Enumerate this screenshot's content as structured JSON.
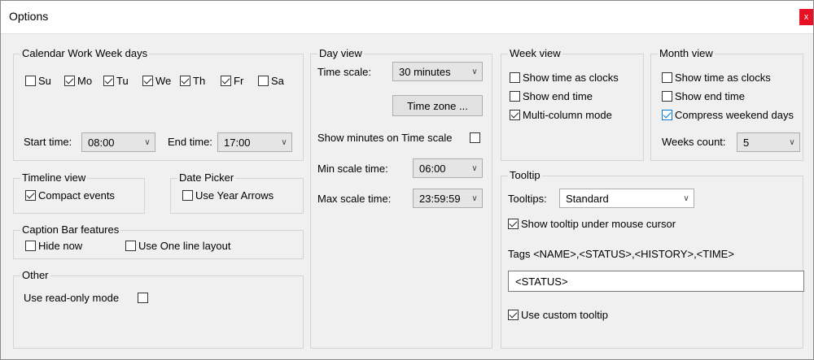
{
  "window": {
    "title": "Options",
    "close_glyph": "x"
  },
  "calendar_work_week": {
    "title": "Calendar Work Week days",
    "days": [
      {
        "label": "Su",
        "checked": false
      },
      {
        "label": "Mo",
        "checked": true
      },
      {
        "label": "Tu",
        "checked": true
      },
      {
        "label": "We",
        "checked": true
      },
      {
        "label": "Th",
        "checked": true
      },
      {
        "label": "Fr",
        "checked": true
      },
      {
        "label": "Sa",
        "checked": false
      }
    ],
    "start_time_label": "Start time:",
    "start_time_value": "08:00",
    "end_time_label": "End time:",
    "end_time_value": "17:00"
  },
  "timeline_view": {
    "title": "Timeline view",
    "compact_events_label": "Compact events",
    "compact_events_checked": true
  },
  "date_picker": {
    "title": "Date Picker",
    "use_year_arrows_label": "Use Year Arrows",
    "use_year_arrows_checked": false
  },
  "caption_bar": {
    "title": "Caption Bar features",
    "hide_now_label": "Hide now",
    "hide_now_checked": false,
    "one_line_label": "Use One line layout",
    "one_line_checked": false
  },
  "other": {
    "title": "Other",
    "read_only_label": "Use read-only mode",
    "read_only_checked": false
  },
  "day_view": {
    "title": "Day view",
    "time_scale_label": "Time scale:",
    "time_scale_value": "30 minutes",
    "time_zone_button": "Time zone ...",
    "show_minutes_label": "Show minutes on Time scale",
    "show_minutes_checked": false,
    "min_scale_label": "Min scale time:",
    "min_scale_value": "06:00",
    "max_scale_label": "Max scale time:",
    "max_scale_value": "23:59:59"
  },
  "week_view": {
    "title": "Week view",
    "clocks_label": "Show time as clocks",
    "clocks_checked": false,
    "end_time_label": "Show end time",
    "end_time_checked": false,
    "multi_column_label": "Multi-column mode",
    "multi_column_checked": true
  },
  "month_view": {
    "title": "Month view",
    "clocks_label": "Show time as clocks",
    "clocks_checked": false,
    "end_time_label": "Show end time",
    "end_time_checked": false,
    "compress_label": "Compress weekend days",
    "compress_checked": true,
    "weeks_count_label": "Weeks count:",
    "weeks_count_value": "5"
  },
  "tooltip": {
    "title": "Tooltip",
    "tooltips_label": "Tooltips:",
    "tooltips_value": "Standard",
    "under_cursor_label": "Show tooltip under mouse cursor",
    "under_cursor_checked": true,
    "tags_label": "Tags <NAME>,<STATUS>,<HISTORY>,<TIME>",
    "tags_value": "<STATUS>",
    "custom_label": "Use custom tooltip",
    "custom_checked": true
  },
  "icons": {
    "dropdown": "chevron-down-icon",
    "checkmark": "check-icon",
    "close": "close-icon"
  },
  "colors": {
    "close_button": "#e81123",
    "accent_checkbox": "#0078d7",
    "dialog_bg": "#f0f0f0"
  }
}
